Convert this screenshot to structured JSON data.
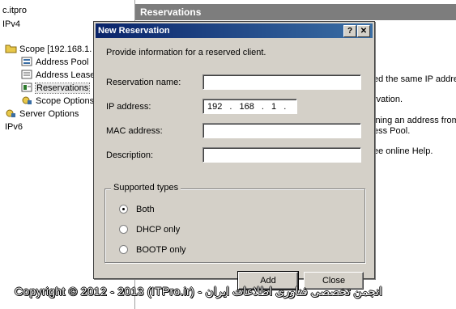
{
  "tree": {
    "items": [
      {
        "label": "c.itpro",
        "icon": "server-icon"
      },
      {
        "label": "IPv4",
        "icon": "network-icon"
      },
      {
        "label": "Scope [192.168.1.",
        "icon": "folder-icon"
      },
      {
        "label": "Address Pool",
        "icon": "pool-icon"
      },
      {
        "label": "Address Lease",
        "icon": "lease-icon"
      },
      {
        "label": "Reservations",
        "icon": "reservation-icon"
      },
      {
        "label": "Scope Options",
        "icon": "options-icon"
      },
      {
        "label": "Server Options",
        "icon": "options-icon"
      },
      {
        "label": "IPv6",
        "icon": "network-icon"
      }
    ]
  },
  "right_panel": {
    "header": "Reservations",
    "lines": [
      "ed the same IP addre",
      "rvation.",
      "ining an address from",
      "ess Pool.",
      "ee online Help."
    ]
  },
  "dialog": {
    "title": "New Reservation",
    "help_button": "?",
    "close_button": "✕",
    "intro": "Provide information for a reserved client.",
    "fields": {
      "reservation_name_label": "Reservation name:",
      "reservation_name_value": "",
      "ip_label": "IP address:",
      "ip_value": "192 . 168 . 1 .",
      "mac_label": "MAC address:",
      "mac_value": "",
      "description_label": "Description:",
      "description_value": ""
    },
    "supported_types": {
      "legend": "Supported types",
      "options": [
        "Both",
        "DHCP only",
        "BOOTP only"
      ],
      "selected": "Both"
    },
    "buttons": {
      "add": "Add",
      "close": "Close"
    }
  },
  "watermark": "Copyright © 2012 - 2013 (ITPro.ir) - انجمن تخصصی فناوری اطلاعات ایران"
}
